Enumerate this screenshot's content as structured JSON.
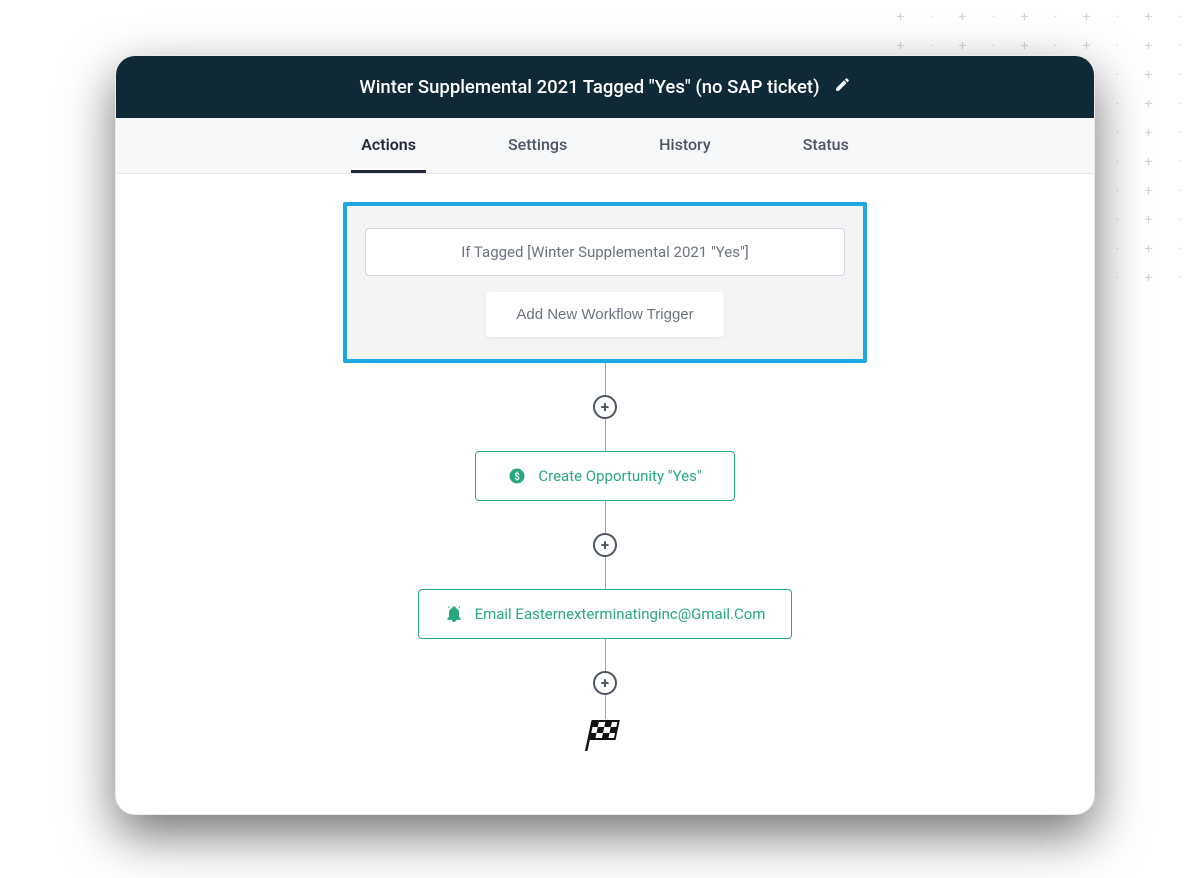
{
  "header": {
    "title": "Winter Supplemental 2021 Tagged \"Yes\" (no SAP ticket)"
  },
  "tabs": [
    {
      "label": "Actions",
      "active": true
    },
    {
      "label": "Settings",
      "active": false
    },
    {
      "label": "History",
      "active": false
    },
    {
      "label": "Status",
      "active": false
    }
  ],
  "trigger": {
    "condition": "If Tagged [Winter Supplemental 2021 \"Yes\"]",
    "add_label": "Add New Workflow Trigger"
  },
  "steps": [
    {
      "icon": "dollar-icon",
      "label": "Create Opportunity \"Yes\""
    },
    {
      "icon": "bell-icon",
      "label": "Email Easternexterminatinginc@Gmail.Com"
    }
  ],
  "colors": {
    "header_bg": "#0f2937",
    "highlight_border": "#1fa7e0",
    "action_green": "#28a97b"
  }
}
